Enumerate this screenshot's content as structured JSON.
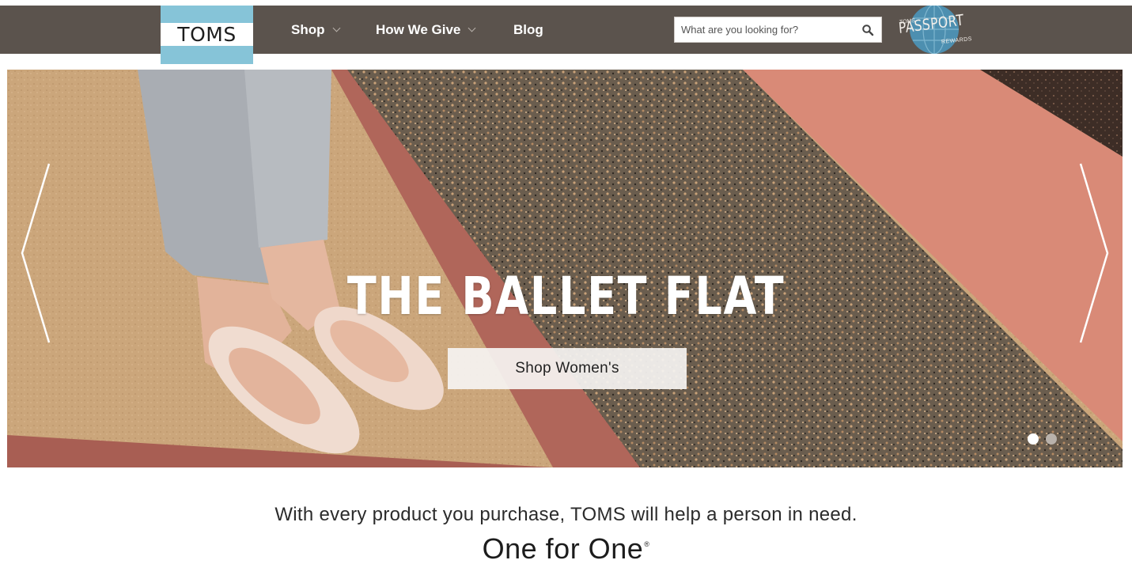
{
  "header": {
    "logo_text": "TOMS",
    "nav": [
      {
        "label": "Shop",
        "has_dropdown": true
      },
      {
        "label": "How We Give",
        "has_dropdown": true
      },
      {
        "label": "Blog",
        "has_dropdown": false
      }
    ],
    "search": {
      "placeholder": "What are you looking for?",
      "value": ""
    },
    "rewards_logo": {
      "small": "TOMS",
      "main": "PASSPORT",
      "sub": "REWARDS"
    }
  },
  "hero": {
    "title": "THE BALLET FLAT",
    "cta_label": "Shop Women's",
    "slides_total": 2,
    "active_slide": 1
  },
  "mission": {
    "tagline": "With every product you purchase, TOMS will help a person in need.",
    "headline": "One for One",
    "headline_mark": "®"
  },
  "colors": {
    "header_bg": "#5b534d",
    "logo_blue": "#86c4d8",
    "floor_tan": "#c9a478",
    "floor_red": "#b0665a",
    "floor_salmon": "#d98a77",
    "floor_speckle": "#6e6152"
  }
}
